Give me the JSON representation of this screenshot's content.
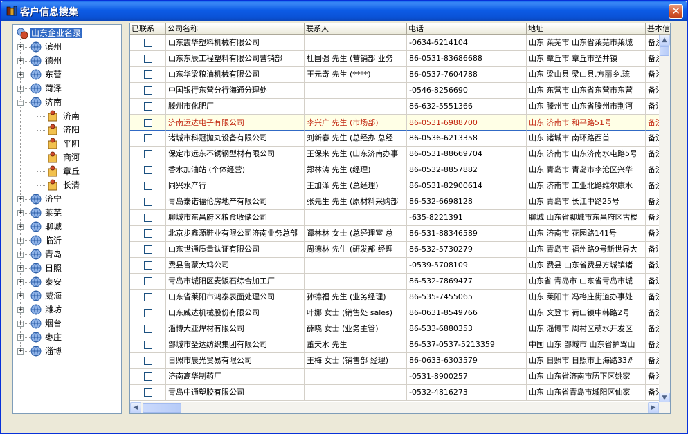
{
  "window": {
    "title": "客户信息搜集",
    "close_label": "✕"
  },
  "tree": {
    "root": "山东企业名录",
    "items": [
      {
        "label": "滨州",
        "expanded": false
      },
      {
        "label": "德州",
        "expanded": false
      },
      {
        "label": "东营",
        "expanded": false
      },
      {
        "label": "菏泽",
        "expanded": false
      },
      {
        "label": "济南",
        "expanded": true,
        "children": [
          "济南",
          "济阳",
          "平阴",
          "商河",
          "章丘",
          "长清"
        ]
      },
      {
        "label": "济宁",
        "expanded": false
      },
      {
        "label": "莱芜",
        "expanded": false
      },
      {
        "label": "聊城",
        "expanded": false
      },
      {
        "label": "临沂",
        "expanded": false
      },
      {
        "label": "青岛",
        "expanded": false
      },
      {
        "label": "日照",
        "expanded": false
      },
      {
        "label": "泰安",
        "expanded": false
      },
      {
        "label": "威海",
        "expanded": false
      },
      {
        "label": "潍坊",
        "expanded": false
      },
      {
        "label": "烟台",
        "expanded": false
      },
      {
        "label": "枣庄",
        "expanded": false
      },
      {
        "label": "淄博",
        "expanded": false
      }
    ]
  },
  "grid": {
    "columns": [
      "已联系",
      "公司名称",
      "联系人",
      "电话",
      "地址",
      "基本信"
    ],
    "rows": [
      {
        "company": "山东震华塑料机械有限公司",
        "contact": "",
        "phone": "-0634-6214104",
        "address": "山东 莱芜市 山东省莱芜市莱城",
        "note": "备注"
      },
      {
        "company": "山东东辰工程塑料有限公司营销部",
        "contact": "杜国强 先生 (营销部 业务",
        "phone": "86-0531-83686688",
        "address": "山东 章丘市 章丘市圣井镇",
        "note": "备注"
      },
      {
        "company": "山东华梁粮油机械有限公司",
        "contact": "王元奇 先生 (****)",
        "phone": "86-0537-7604788",
        "address": "山东 梁山县 梁山县.方丽乡.琉",
        "note": "备注"
      },
      {
        "company": "中国银行东营分行海通分理处",
        "contact": "",
        "phone": "-0546-8256690",
        "address": "山东 东营市 山东省东营市东营",
        "note": "备注"
      },
      {
        "company": "滕州市化肥厂",
        "contact": "",
        "phone": "86-632-5551366",
        "address": "山东 滕州市 山东省滕州市荆河",
        "note": "备注"
      },
      {
        "company": "济南运达电子有限公司",
        "contact": "李兴广 先生 (市场部)",
        "phone": "86-0531-6988700",
        "address": "山东 济南市 和平路51号",
        "note": "备注",
        "highlight": true
      },
      {
        "company": "诸城市科冠抛丸设备有限公司",
        "contact": "刘新春 先生 (总经办 总经",
        "phone": "86-0536-6213358",
        "address": "山东 诸城市 南环路西首",
        "note": "备注"
      },
      {
        "company": "保定市远东不锈钢型材有限公司",
        "contact": "王保来 先生 (山东济南办事",
        "phone": "86-0531-88669704",
        "address": "山东 济南市 山东济南水屯路5号",
        "note": "备注"
      },
      {
        "company": "香水加油站 (个体经营)",
        "contact": "郑林涛 先生 (经理)",
        "phone": "86-0532-8857882",
        "address": "山东 青岛市 青岛市李沧区兴华",
        "note": "备注"
      },
      {
        "company": "同兴水产行",
        "contact": "王加泽 先生 (总经理)",
        "phone": "86-0531-82900614",
        "address": "山东 济南市 工业北路维尔康水",
        "note": "备注"
      },
      {
        "company": "青岛泰诺福伦房地产有限公司",
        "contact": "张先生 先生 (原材料采购部",
        "phone": "86-532-6698128",
        "address": "山东 青岛市 长江中路25号",
        "note": "备注"
      },
      {
        "company": "聊城市东昌府区粮食收储公司",
        "contact": "",
        "phone": "-635-8221391",
        "address": "聊城 山东省聊城市东昌府区古楼",
        "note": "备注"
      },
      {
        "company": "北京步鑫源鞋业有限公司济南业务总部",
        "contact": "谭林林 女士 (总经理室 总",
        "phone": "86-531-88346589",
        "address": "山东 济南市 花园路141号",
        "note": "备注"
      },
      {
        "company": "山东世通质量认证有限公司",
        "contact": "周德林 先生 (研发部 经理",
        "phone": "86-532-5730279",
        "address": "山东 青岛市 福州路9号新世界大",
        "note": "备注"
      },
      {
        "company": "费县鲁蒙大鸡公司",
        "contact": "",
        "phone": "-0539-5708109",
        "address": "山东 费县 山东省费县方城镇诸",
        "note": "备注"
      },
      {
        "company": "青岛市城阳区麦饭石综合加工厂",
        "contact": "",
        "phone": "86-532-7869477",
        "address": "山东省 青岛市 山东省青岛市城",
        "note": "备注"
      },
      {
        "company": "山东省莱阳市鸿泰表面处理公司",
        "contact": "孙德福 先生 (业务经理)",
        "phone": "86-535-7455065",
        "address": "山东 莱阳市 冯格庄街道办事处",
        "note": "备注"
      },
      {
        "company": "山东威达机械股份有限公司",
        "contact": "叶娜 女士 (销售处 sales)",
        "phone": "86-0631-8549766",
        "address": "山东 文登市 荷山镇中韩路2号",
        "note": "备注"
      },
      {
        "company": "淄博大亚焊材有限公司",
        "contact": "薛晓 女士 (业务主管)",
        "phone": "86-533-6880353",
        "address": "山东 淄博市 周村区萌水开发区",
        "note": "备注"
      },
      {
        "company": "邹城市圣达纺织集团有限公司",
        "contact": "董天水 先生",
        "phone": "86-537-0537-5213359",
        "address": "中国 山东 邹城市 山东省护驾山",
        "note": "备注"
      },
      {
        "company": "日照市晨光贸易有限公司",
        "contact": "王梅 女士 (销售部 经理)",
        "phone": "86-0633-6303579",
        "address": "山东 日照市 日照市上海路33#",
        "note": "备注"
      },
      {
        "company": "济南高华制药厂",
        "contact": "",
        "phone": "-0531-8900257",
        "address": "山东  山东省济南市历下区姚家",
        "note": "备注"
      },
      {
        "company": "青岛中通塑胶有限公司",
        "contact": "",
        "phone": "-0532-4816273",
        "address": "山东  山东省青岛市城阳区仙家",
        "note": "备注"
      }
    ]
  },
  "colors": {
    "accent": "#316ac5",
    "highlight_text": "#c2260f",
    "highlight_bg": "#ffffe6"
  }
}
